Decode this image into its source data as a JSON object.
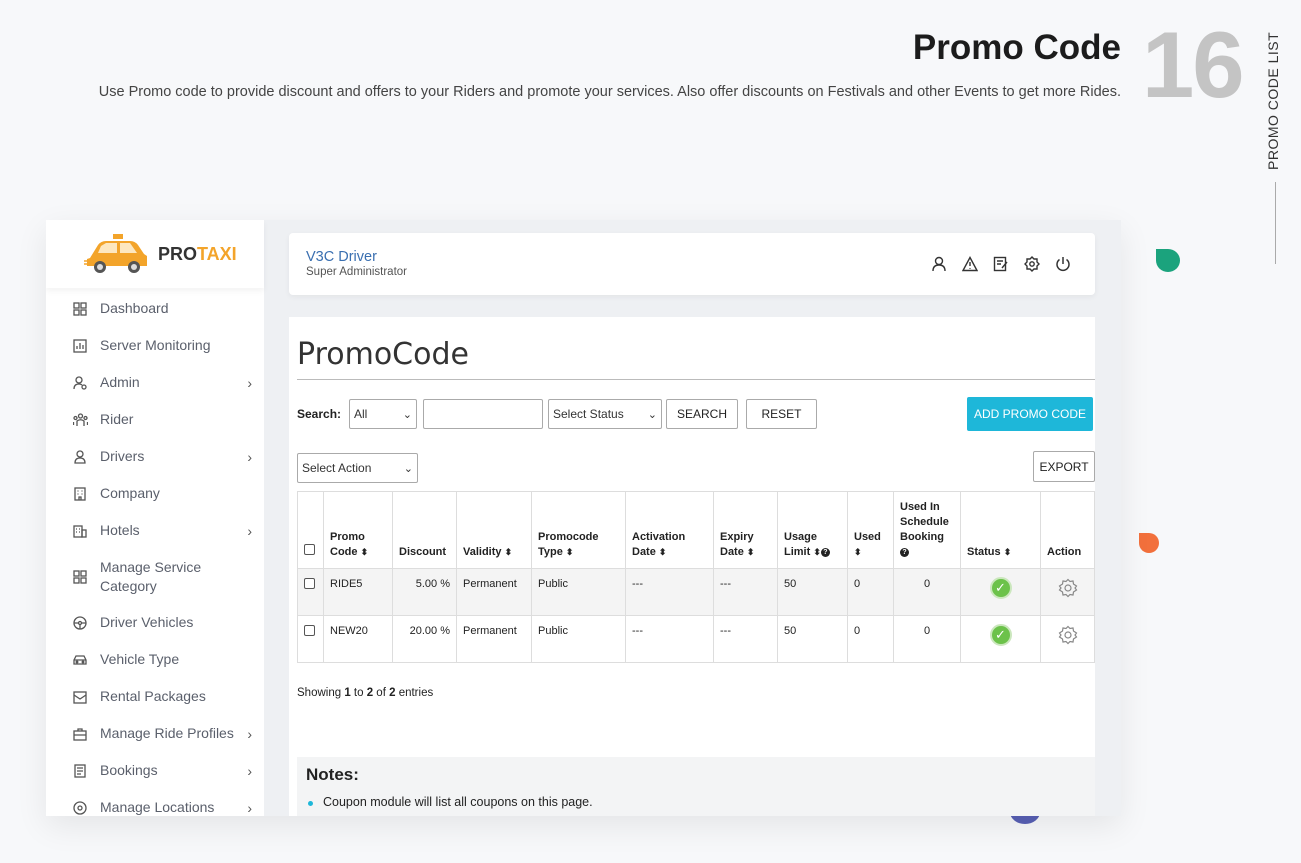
{
  "slide": {
    "title": "Promo Code",
    "description": "Use Promo code to provide discount and offers to your Riders and promote your services. Also offer discounts on Festivals and other Events to get more Rides.",
    "number": "16",
    "side_label": "PROMO CODE LIST"
  },
  "logo": {
    "brand_a": "PRO",
    "brand_b": "TAXI"
  },
  "sidebar": {
    "items": [
      {
        "label": "Dashboard",
        "icon": "dashboard-icon",
        "arrow": ""
      },
      {
        "label": "Server Monitoring",
        "icon": "chart-icon",
        "arrow": ""
      },
      {
        "label": "Admin",
        "icon": "admin-icon",
        "arrow": "›"
      },
      {
        "label": "Rider",
        "icon": "rider-icon",
        "arrow": ""
      },
      {
        "label": "Drivers",
        "icon": "driver-icon",
        "arrow": "›"
      },
      {
        "label": "Company",
        "icon": "company-icon",
        "arrow": ""
      },
      {
        "label": "Hotels",
        "icon": "hotel-icon",
        "arrow": "›"
      },
      {
        "label": "Manage Service Category",
        "icon": "category-icon",
        "arrow": ""
      },
      {
        "label": "Driver Vehicles",
        "icon": "steering-icon",
        "arrow": ""
      },
      {
        "label": "Vehicle Type",
        "icon": "car-icon",
        "arrow": ""
      },
      {
        "label": "Rental Packages",
        "icon": "package-icon",
        "arrow": ""
      },
      {
        "label": "Manage Ride Profiles",
        "icon": "briefcase-icon",
        "arrow": "›"
      },
      {
        "label": "Bookings",
        "icon": "bookings-icon",
        "arrow": "›"
      },
      {
        "label": "Manage Locations",
        "icon": "location-icon",
        "arrow": "›"
      }
    ]
  },
  "topbar": {
    "user_name": "V3C Driver",
    "user_role": "Super Administrator"
  },
  "page": {
    "title": "PromoCode",
    "search_label": "Search:",
    "filter_all": "All",
    "status_placeholder": "Select Status",
    "search_button": "SEARCH",
    "reset_button": "RESET",
    "add_button": "ADD PROMO CODE",
    "action_select": "Select Action",
    "export_button": "EXPORT"
  },
  "table": {
    "headers": {
      "code": "Promo Code",
      "discount": "Discount",
      "validity": "Validity",
      "type": "Promocode Type",
      "activation": "Activation Date",
      "expiry": "Expiry Date",
      "usage": "Usage Limit",
      "used": "Used",
      "schedule": "Used In Schedule Booking",
      "status": "Status",
      "action": "Action"
    },
    "rows": [
      {
        "code": "RIDE5",
        "discount": "5.00 %",
        "validity": "Permanent",
        "type": "Public",
        "activation": "---",
        "expiry": "---",
        "usage": "50",
        "used": "0",
        "schedule": "0"
      },
      {
        "code": "NEW20",
        "discount": "20.00 %",
        "validity": "Permanent",
        "type": "Public",
        "activation": "---",
        "expiry": "---",
        "usage": "50",
        "used": "0",
        "schedule": "0"
      }
    ]
  },
  "showing": {
    "prefix": "Showing ",
    "from": "1",
    "to_word": " to ",
    "to": "2",
    "of_word": " of ",
    "total": "2",
    "suffix": " entries"
  },
  "notes": {
    "title": "Notes:",
    "item": "Coupon module will list all coupons on this page."
  },
  "colors": {
    "accent": "#1eb7d9",
    "logo_orange": "#f3a42a",
    "status_green": "#6cc24a"
  }
}
